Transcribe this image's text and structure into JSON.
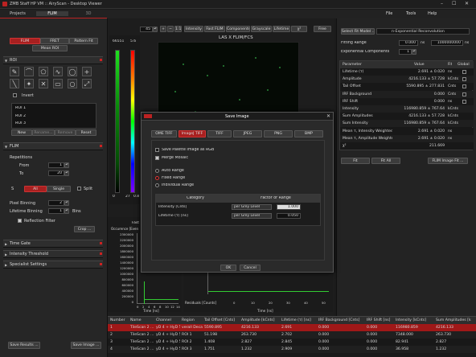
{
  "window": {
    "title": "ZMB Staff HP VM :: AiryScan - Desktop Viewer",
    "minimize": "–",
    "maximize": "☐",
    "close": "✕"
  },
  "menu": {
    "file": "File",
    "tools": "Tools",
    "help": "Help"
  },
  "left_tabs": [
    "Projects",
    "FLIM",
    "3D"
  ],
  "mode_buttons": {
    "flim": "FLIM",
    "fret": "FRET",
    "pattern_fit": "Pattern Fit",
    "mean_roi": "Mean ROI"
  },
  "roi": {
    "header": "ROI",
    "invert": "Invert",
    "new": "New",
    "rename": "Rename...",
    "remove": "Remove",
    "reset": "Reset",
    "items": [
      "ROI 1",
      "ROI 2",
      "ROI 3"
    ]
  },
  "flim_panel": {
    "header": "FLIM",
    "repetitions": "Repetitions",
    "from_label": "From",
    "from_value": "1",
    "to_label": "To",
    "to_value": "20",
    "s_label": "S",
    "all": "All",
    "single": "Single",
    "split": "Split",
    "pixel_binning_label": "Pixel Binning",
    "pixel_binning_value": "2",
    "lifetime_binning_label": "Lifetime Binning",
    "lifetime_binning_value": "1",
    "bins": "Bins",
    "reflection_filter": "Reflection Filter",
    "crop": "Crop ..."
  },
  "collapsed_sections": [
    "Time Gate",
    "Intensity Threshold",
    "Specialist Settings"
  ],
  "bottom_left": {
    "save_results": "Save Results ...",
    "save_image": "Save Image ..."
  },
  "colorbar": {
    "max": "66551",
    "min": "0",
    "right_max": "5.6",
    "right_min": "0.8",
    "right_min_b": "27"
  },
  "viewer_toolbar": {
    "zoom": "45",
    "intensity": "Intensity",
    "fast_flim": "Fast FLIM",
    "components": "Components",
    "grayscale": "Grayscale",
    "lifetime": "Lifetime",
    "chi": "χ²",
    "free": "Free"
  },
  "image_title": "LAS X FLIM/FCS",
  "lower_left_plot": {
    "title": "Fast",
    "ylabel": "Occurence [Even",
    "xlabel": "Time [ns]",
    "yticks": [
      "2300000",
      "2200000",
      "2000000",
      "1800000",
      "1600000",
      "1400000",
      "1200000",
      "1000000",
      "800000",
      "600000",
      "400000",
      "200000",
      "0"
    ],
    "xticks": [
      "0",
      "2",
      "4",
      "6",
      "8",
      "10",
      "12",
      "14"
    ]
  },
  "residuals": {
    "label": "Residuals [Counts]",
    "xlabel": "Time [ns]",
    "xticks": [
      "0",
      "10",
      "20",
      "30",
      "40",
      "50"
    ]
  },
  "fit": {
    "select_fit_model": "Select Fit Model ...",
    "model_name": "n-Exponential Reconvolution",
    "fitting_range_label": "Fitting Range",
    "range_from": "0.000",
    "range_unit1": "ns",
    "range_to": "1000000000",
    "range_unit2": "ns",
    "exp_components_label": "Exponential Components",
    "exp_components_value": "1",
    "table_headers": [
      "Parameter",
      "Value",
      "Fit",
      "Global"
    ],
    "rows": [
      {
        "name": "Lifetime (τ)",
        "value": "2.691 ± 0.020",
        "unit": "ns"
      },
      {
        "name": "Amplitude",
        "value": "4216.133 ± 57.728",
        "unit": "kCnts"
      },
      {
        "name": "Tail Offset",
        "value": "5590.895 ± 277.831",
        "unit": "Cnts"
      },
      {
        "name": "IRF Background",
        "value": "0.000",
        "unit": "Cnts"
      },
      {
        "name": "IRF Shift",
        "value": "0.000",
        "unit": "ns"
      },
      {
        "name": "Intensity",
        "value": "116980.859 ± 767.64",
        "unit": "kCnts"
      },
      {
        "name": "Sum Amplitudes",
        "value": "4216.133 ± 57.728",
        "unit": "kCnts"
      },
      {
        "name": "Sum Intensity",
        "value": "116980.859 ± 767.64",
        "unit": "kCnts"
      },
      {
        "name": "Mean τ, Intensity Weighted",
        "value": "2.691 ± 0.020",
        "unit": "ns"
      },
      {
        "name": "Mean τ, Amplitude Weighted",
        "value": "2.691 ± 0.020",
        "unit": "ns"
      },
      {
        "name": "χ²",
        "value": "211.669",
        "unit": ""
      }
    ],
    "fit_btn": "Fit",
    "fit_all_btn": "Fit All",
    "flim_image_fit_btn": "FLIM Image Fit ..."
  },
  "results_table": {
    "headers": [
      "Number",
      "Name",
      "Channel",
      "Region",
      "Tail Offset [Cnts]",
      "Amplitude [kCnts]",
      "Lifetime (τ) [ns]",
      "IRF Background [Cnts]",
      "IRF Shift [ns]",
      "Intensity [kCnts]",
      "Sum Amplitudes [k"
    ],
    "rows": [
      [
        "1",
        "TileScan 2 ...",
        "yD 4 + HyD 5",
        "verall Decay",
        "5590.895",
        "4216.133",
        "2.691",
        "0.000",
        "0.000",
        "116980.859",
        "4216.133"
      ],
      [
        "2",
        "TileScan 2 ...",
        "yD 4 + HyD 5",
        "ROI 1",
        "51.198",
        "263.730",
        "2.702",
        "0.000",
        "0.000",
        "7348.000",
        "263.730"
      ],
      [
        "3",
        "TileScan 2 ...",
        "yD 4 + HyD 5",
        "ROI 2",
        "1.408",
        "2.827",
        "2.845",
        "0.000",
        "0.000",
        "82.941",
        "2.827"
      ],
      [
        "4",
        "TileScan 2 ...",
        "yD 4 + HyD 5",
        "ROI 3",
        "1.751",
        "1.232",
        "2.909",
        "0.000",
        "0.000",
        "36.958",
        "1.232"
      ]
    ]
  },
  "dialog": {
    "title": "Save Image",
    "close": "✕",
    "tabs": [
      "OME TIFF",
      "ImageJ TIFF",
      "TIFF",
      "JPEG",
      "PNG",
      "BMP"
    ],
    "save_palette": "Save Palette Image as RGB",
    "merge_mosaic": "Merge Mosaic",
    "auto_range": "Auto Range",
    "fixed_range": "Fixed Range",
    "individual_range": "Individual Range",
    "col_category": "Category",
    "col_factor": "Factor or Range",
    "rows": [
      {
        "category": "Intensity [Cnts]",
        "mode": "per Grey Level",
        "value": "1.000"
      },
      {
        "category": "Lifetime (τ) [ns]",
        "mode": "per Grey Level",
        "value": "0.050"
      }
    ],
    "ok": "OK",
    "cancel": "Cancel"
  }
}
